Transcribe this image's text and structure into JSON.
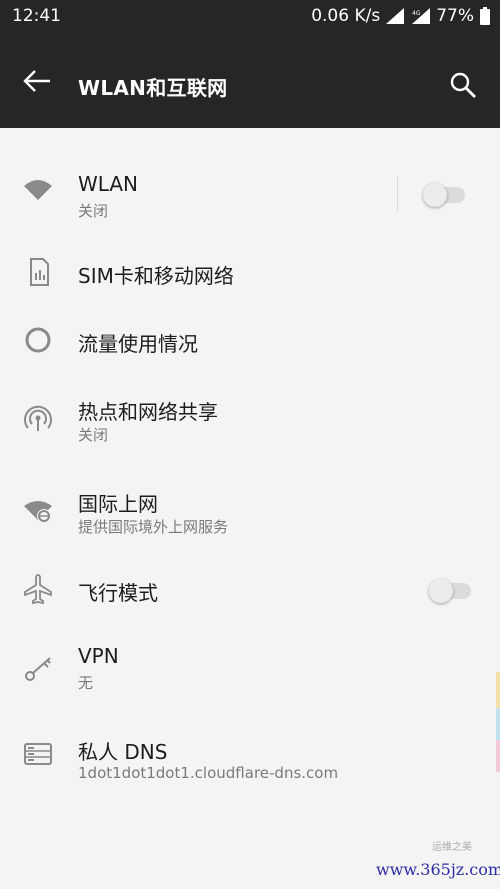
{
  "status_bar": {
    "time": "12:41",
    "speed": "0.06 K/s",
    "battery": "77%",
    "network_badge": "4G"
  },
  "app_bar": {
    "title": "WLAN和互联网",
    "back_icon": "arrow-back-icon",
    "search_icon": "search-icon"
  },
  "items": [
    {
      "icon": "wifi-icon",
      "label": "WLAN",
      "sub": "关闭",
      "toggle": "off"
    },
    {
      "icon": "sim-card-icon",
      "label": "SIM卡和移动网络",
      "sub": ""
    },
    {
      "icon": "data-usage-icon",
      "label": "流量使用情况",
      "sub": ""
    },
    {
      "icon": "hotspot-icon",
      "label": "热点和网络共享",
      "sub": "关闭"
    },
    {
      "icon": "global-network-icon",
      "label": "国际上网",
      "sub": "提供国际境外上网服务"
    },
    {
      "icon": "airplane-icon",
      "label": "飞行模式",
      "sub": "",
      "toggle": "off"
    },
    {
      "icon": "vpn-key-icon",
      "label": "VPN",
      "sub": "无"
    },
    {
      "icon": "private-dns-icon",
      "label": "私人 DNS",
      "sub": "1dot1dot1dot1.cloudflare-dns.com"
    }
  ],
  "watermark": "www.365jz.com",
  "watermark_small": "运维之美",
  "colors": {
    "bar_bg": "#262626",
    "page_bg": "#f4f4f4",
    "text_primary": "#1d1d1d",
    "text_secondary": "#7a7a7a",
    "icon": "#8a8a8a"
  }
}
